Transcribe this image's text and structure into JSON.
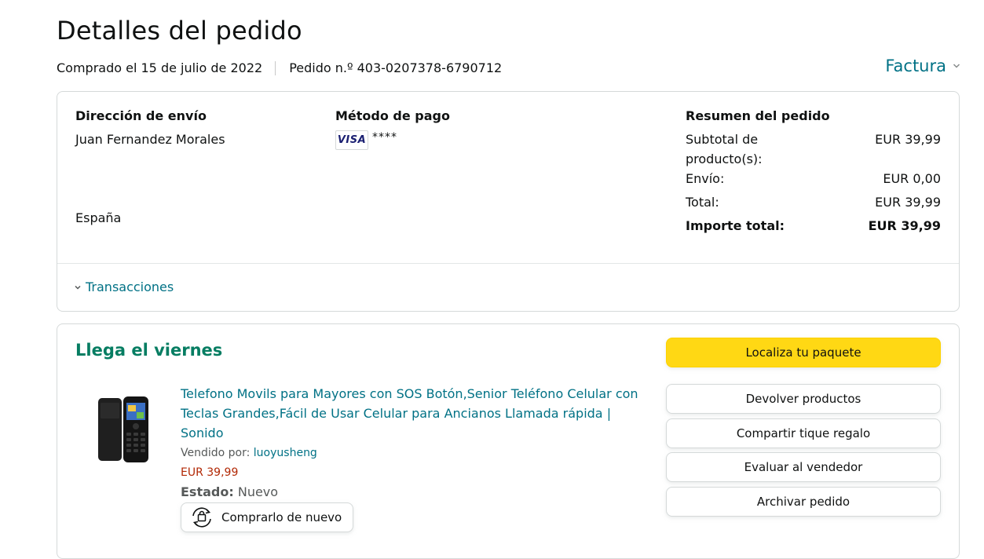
{
  "page": {
    "title": "Detalles del pedido",
    "purchase_date": "Comprado el 15 de julio de 2022",
    "order_number": "Pedido n.º 403-0207378-6790712",
    "invoice_label": "Factura"
  },
  "shipping": {
    "heading": "Dirección de envío",
    "name": "Juan Fernandez Morales",
    "country": "España"
  },
  "payment": {
    "heading": "Método de pago",
    "card_brand": "VISA",
    "masked": "****"
  },
  "summary": {
    "heading": "Resumen del pedido",
    "subtotal_label": "Subtotal de producto(s):",
    "subtotal_value": "EUR 39,99",
    "shipping_label": "Envío:",
    "shipping_value": "EUR 0,00",
    "total_label": "Total:",
    "total_value": "EUR 39,99",
    "grand_label": "Importe total:",
    "grand_value": "EUR 39,99"
  },
  "transactions_label": "Transacciones",
  "delivery": {
    "status": "Llega el viernes",
    "product_title": "Telefono Movils para Mayores con SOS Botón,Senior Teléfono Celular con Teclas Grandes,Fácil de Usar Celular para Ancianos Llamada rápida | Sonido",
    "seller_prefix": "Vendido por:",
    "seller_name": "luoyusheng",
    "price": "EUR 39,99",
    "state_label": "Estado:",
    "state_value": "Nuevo",
    "buy_again": "Comprarlo de nuevo"
  },
  "actions": {
    "track": "Localiza tu paquete",
    "return": "Devolver productos",
    "gift_receipt": "Compartir tique regalo",
    "rate_seller": "Evaluar al vendedor",
    "archive": "Archivar pedido"
  },
  "colors": {
    "link": "#007185",
    "arrival_green": "#067d62",
    "price_red": "#b12704",
    "primary_button": "#ffd814"
  }
}
